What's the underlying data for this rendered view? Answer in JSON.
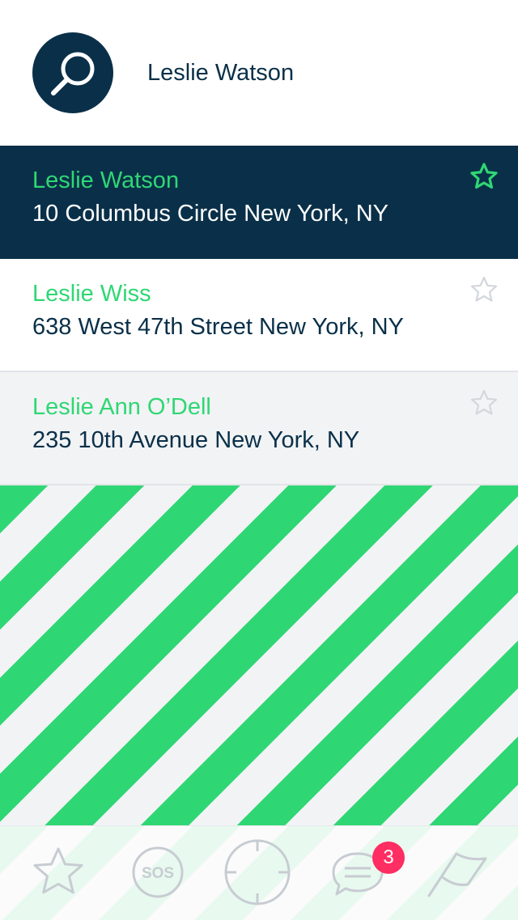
{
  "search": {
    "value": "Leslie Watson"
  },
  "results": [
    {
      "name": "Leslie Watson",
      "address": "10 Columbus Circle New York, NY",
      "favorite": true,
      "selected": true
    },
    {
      "name": "Leslie Wiss",
      "address": "638 West 47th Street New York, NY",
      "favorite": false,
      "selected": false
    },
    {
      "name": "Leslie Ann O’Dell",
      "address": "235 10th Avenue New York, NY",
      "favorite": false,
      "selected": false
    }
  ],
  "tabbar": {
    "sos_label": "SOS",
    "messages_badge": "3",
    "icons": [
      "star-icon",
      "sos-icon",
      "crosshair-icon",
      "chat-icon",
      "flag-icon"
    ]
  },
  "colors": {
    "navy": "#0a3049",
    "green": "#2fd774",
    "stripe_light": "#f2f3f5",
    "badge": "#fe2d62",
    "icon_gray": "#c7ccd2"
  }
}
